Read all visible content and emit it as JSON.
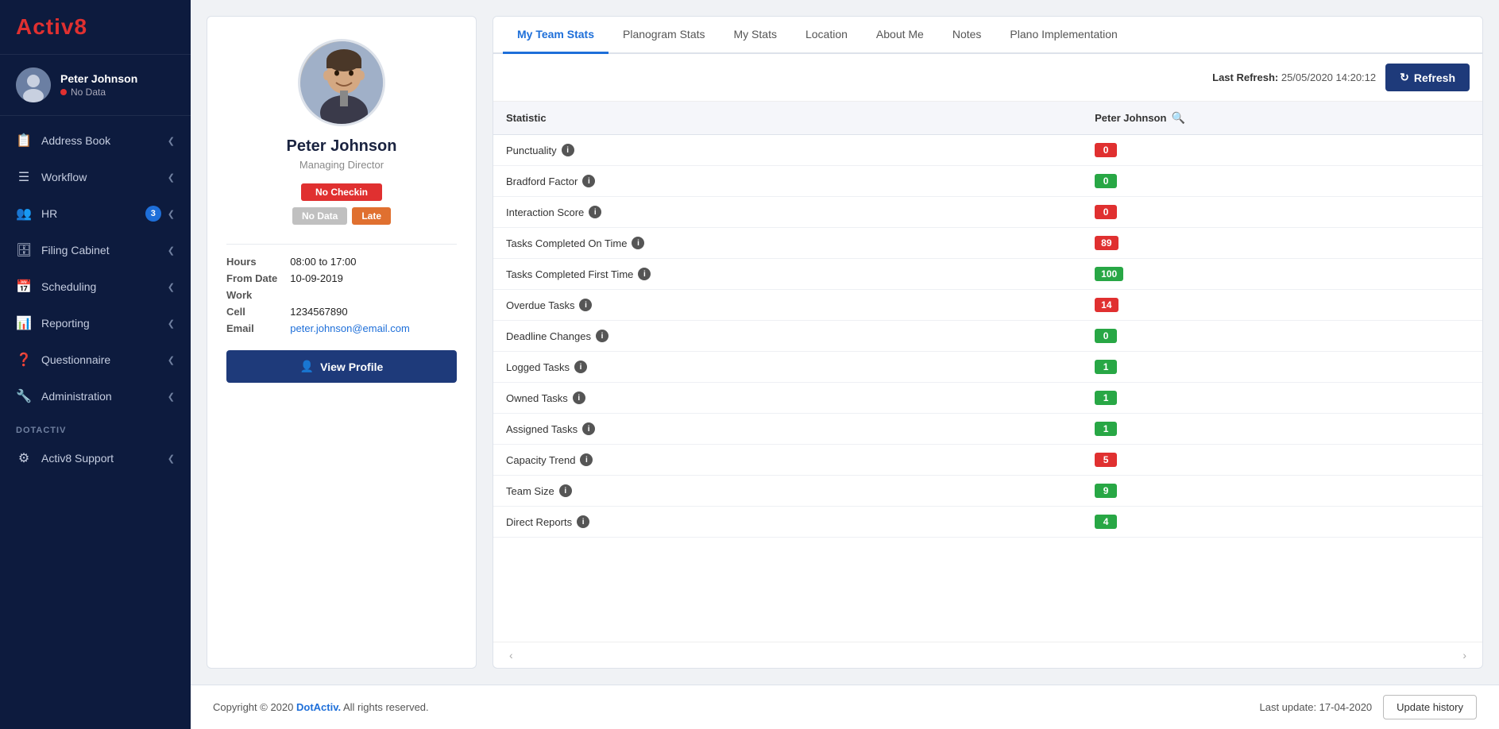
{
  "sidebar": {
    "logo": {
      "text_main": "Activ",
      "text_accent": "8"
    },
    "user": {
      "name": "Peter Johnson",
      "status": "No Data"
    },
    "nav_items": [
      {
        "id": "address-book",
        "label": "Address Book",
        "icon": "📋",
        "badge": null,
        "has_chevron": true
      },
      {
        "id": "workflow",
        "label": "Workflow",
        "icon": "☰",
        "badge": null,
        "has_chevron": true
      },
      {
        "id": "hr",
        "label": "HR",
        "icon": "👥",
        "badge": "3",
        "has_chevron": true
      },
      {
        "id": "filing-cabinet",
        "label": "Filing Cabinet",
        "icon": "🗄",
        "badge": null,
        "has_chevron": true
      },
      {
        "id": "scheduling",
        "label": "Scheduling",
        "icon": "📅",
        "badge": null,
        "has_chevron": true
      },
      {
        "id": "reporting",
        "label": "Reporting",
        "icon": "📊",
        "badge": null,
        "has_chevron": true
      },
      {
        "id": "questionnaire",
        "label": "Questionnaire",
        "icon": "❓",
        "badge": null,
        "has_chevron": true
      },
      {
        "id": "administration",
        "label": "Administration",
        "icon": "🔧",
        "badge": null,
        "has_chevron": true
      }
    ],
    "section_label": "DOTACTIV",
    "support_item": {
      "id": "activ8-support",
      "label": "Activ8 Support",
      "icon": "⚙",
      "has_chevron": true
    }
  },
  "profile": {
    "name": "Peter Johnson",
    "title": "Managing Director",
    "badges": [
      {
        "id": "checkin",
        "label": "No Checkin",
        "color": "red"
      },
      {
        "id": "data",
        "label": "No Data",
        "color": "gray"
      },
      {
        "id": "late",
        "label": "Late",
        "color": "orange"
      }
    ],
    "details": [
      {
        "label": "Hours",
        "value": "08:00 to 17:00",
        "is_email": false
      },
      {
        "label": "From Date",
        "value": "10-09-2019",
        "is_email": false
      },
      {
        "label": "Work",
        "value": "",
        "is_email": false
      },
      {
        "label": "Cell",
        "value": "1234567890",
        "is_email": false
      },
      {
        "label": "Email",
        "value": "peter.johnson@email.com",
        "is_email": true
      }
    ],
    "view_profile_btn": "View Profile"
  },
  "stats": {
    "tabs": [
      {
        "id": "my-team-stats",
        "label": "My Team Stats",
        "active": true
      },
      {
        "id": "planogram-stats",
        "label": "Planogram Stats",
        "active": false
      },
      {
        "id": "my-stats",
        "label": "My Stats",
        "active": false
      },
      {
        "id": "location",
        "label": "Location",
        "active": false
      },
      {
        "id": "about-me",
        "label": "About Me",
        "active": false
      },
      {
        "id": "notes",
        "label": "Notes",
        "active": false
      },
      {
        "id": "plano-implementation",
        "label": "Plano Implementation",
        "active": false
      }
    ],
    "last_refresh_label": "Last Refresh:",
    "last_refresh_value": "25/05/2020 14:20:12",
    "refresh_btn": "Refresh",
    "table_header_statistic": "Statistic",
    "table_header_user": "Peter Johnson",
    "rows": [
      {
        "stat": "Punctuality",
        "value": "0",
        "color": "red"
      },
      {
        "stat": "Bradford Factor",
        "value": "0",
        "color": "green"
      },
      {
        "stat": "Interaction Score",
        "value": "0",
        "color": "red"
      },
      {
        "stat": "Tasks Completed On Time",
        "value": "89",
        "color": "red"
      },
      {
        "stat": "Tasks Completed First Time",
        "value": "100",
        "color": "green"
      },
      {
        "stat": "Overdue Tasks",
        "value": "14",
        "color": "red"
      },
      {
        "stat": "Deadline Changes",
        "value": "0",
        "color": "green"
      },
      {
        "stat": "Logged Tasks",
        "value": "1",
        "color": "green"
      },
      {
        "stat": "Owned Tasks",
        "value": "1",
        "color": "green"
      },
      {
        "stat": "Assigned Tasks",
        "value": "1",
        "color": "green"
      },
      {
        "stat": "Capacity Trend",
        "value": "5",
        "color": "red"
      },
      {
        "stat": "Team Size",
        "value": "9",
        "color": "green"
      },
      {
        "stat": "Direct Reports",
        "value": "4",
        "color": "green"
      }
    ]
  },
  "footer": {
    "copyright": "Copyright © 2020",
    "brand": "DotActiv.",
    "rights": "All rights reserved.",
    "last_update_label": "Last update: 17-04-2020",
    "update_history_btn": "Update history"
  }
}
